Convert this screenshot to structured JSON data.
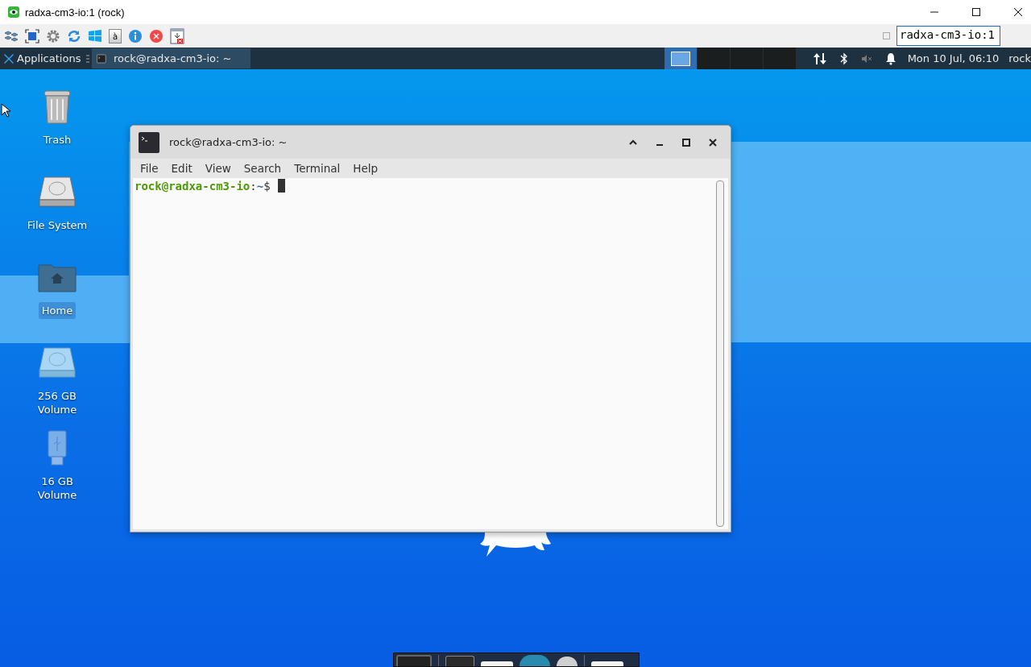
{
  "viewer": {
    "title": "radxa-cm3-io:1 (rock)",
    "key_label": "à",
    "host_field": "radxa-cm3-io:1"
  },
  "panel": {
    "menu_label": "Applications",
    "tasks": [
      {
        "label": "rock@radxa-cm3-io: ~",
        "selected": true
      }
    ],
    "workspaces": [
      {
        "selected": true
      },
      {
        "selected": false
      },
      {
        "selected": false
      },
      {
        "selected": false
      }
    ],
    "clock": "Mon 10 Jul, 06:10",
    "user": "rock"
  },
  "desktop_icons": [
    {
      "kind": "trash",
      "label": "Trash",
      "selected": false
    },
    {
      "kind": "drive",
      "label": "File System",
      "selected": false
    },
    {
      "kind": "home",
      "label": "Home",
      "selected": true
    },
    {
      "kind": "volume",
      "label": "256 GB Volume",
      "selected": false
    },
    {
      "kind": "usb",
      "label": "16 GB Volume",
      "selected": false
    }
  ],
  "terminal": {
    "title": "rock@radxa-cm3-io: ~",
    "menu": [
      "File",
      "Edit",
      "View",
      "Search",
      "Terminal",
      "Help"
    ],
    "prompt": {
      "user_host": "rock@radxa-cm3-io",
      "separator": ":",
      "path": "~",
      "symbol": "$"
    }
  }
}
